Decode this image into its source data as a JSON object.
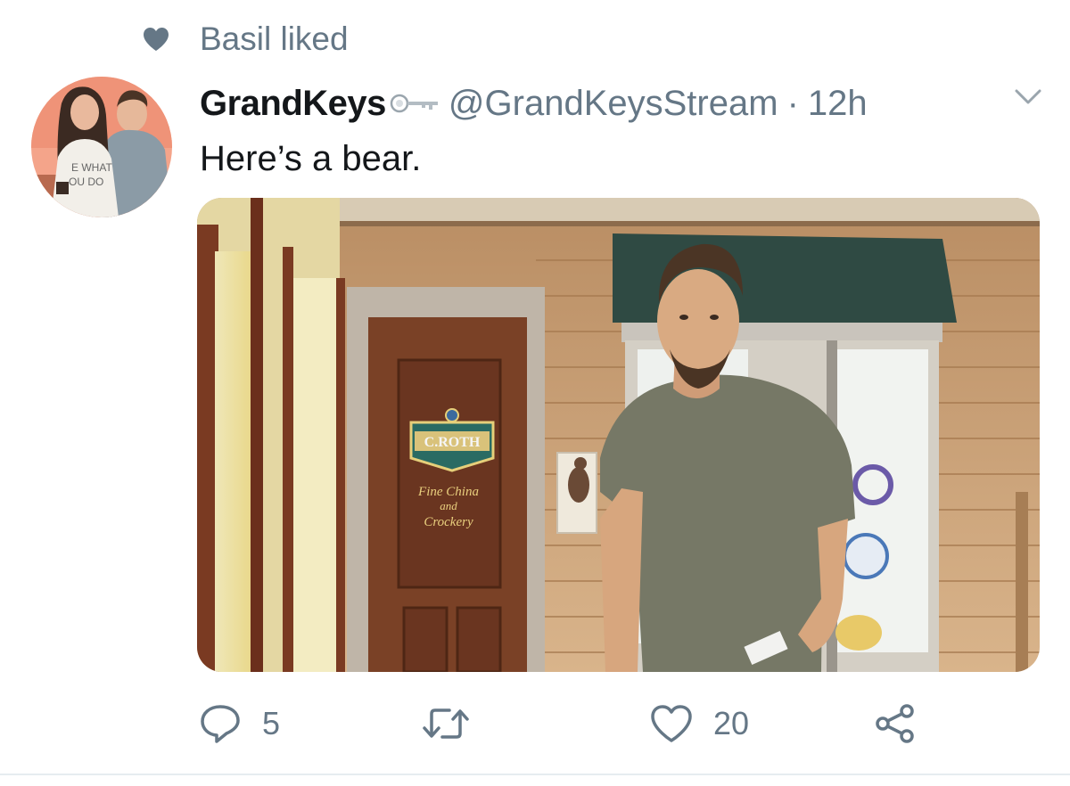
{
  "social_context": {
    "icon": "heart-icon",
    "text": "Basil liked"
  },
  "tweet": {
    "author_name": "GrandKeys",
    "author_badge_icon": "key-icon",
    "handle": "@GrandKeysStream",
    "separator": "·",
    "timestamp": "12h",
    "text": "Here’s a bear.",
    "avatar": {
      "shirt_text_line1": "E WHAT",
      "shirt_text_line2": "OU DO"
    },
    "media": {
      "door_sign_name": "C.ROTH",
      "door_sign_line1": "Fine China",
      "door_sign_line2": "and",
      "door_sign_line3": "Crockery"
    }
  },
  "actions": {
    "reply": {
      "icon": "reply-icon",
      "count": "5"
    },
    "retweet": {
      "icon": "retweet-icon",
      "count": ""
    },
    "like": {
      "icon": "heart-outline-icon",
      "count": "20"
    },
    "share": {
      "icon": "share-icon"
    }
  },
  "colors": {
    "secondary_text": "#657786",
    "primary_text": "#14171a",
    "divider": "#e6ecf0"
  }
}
